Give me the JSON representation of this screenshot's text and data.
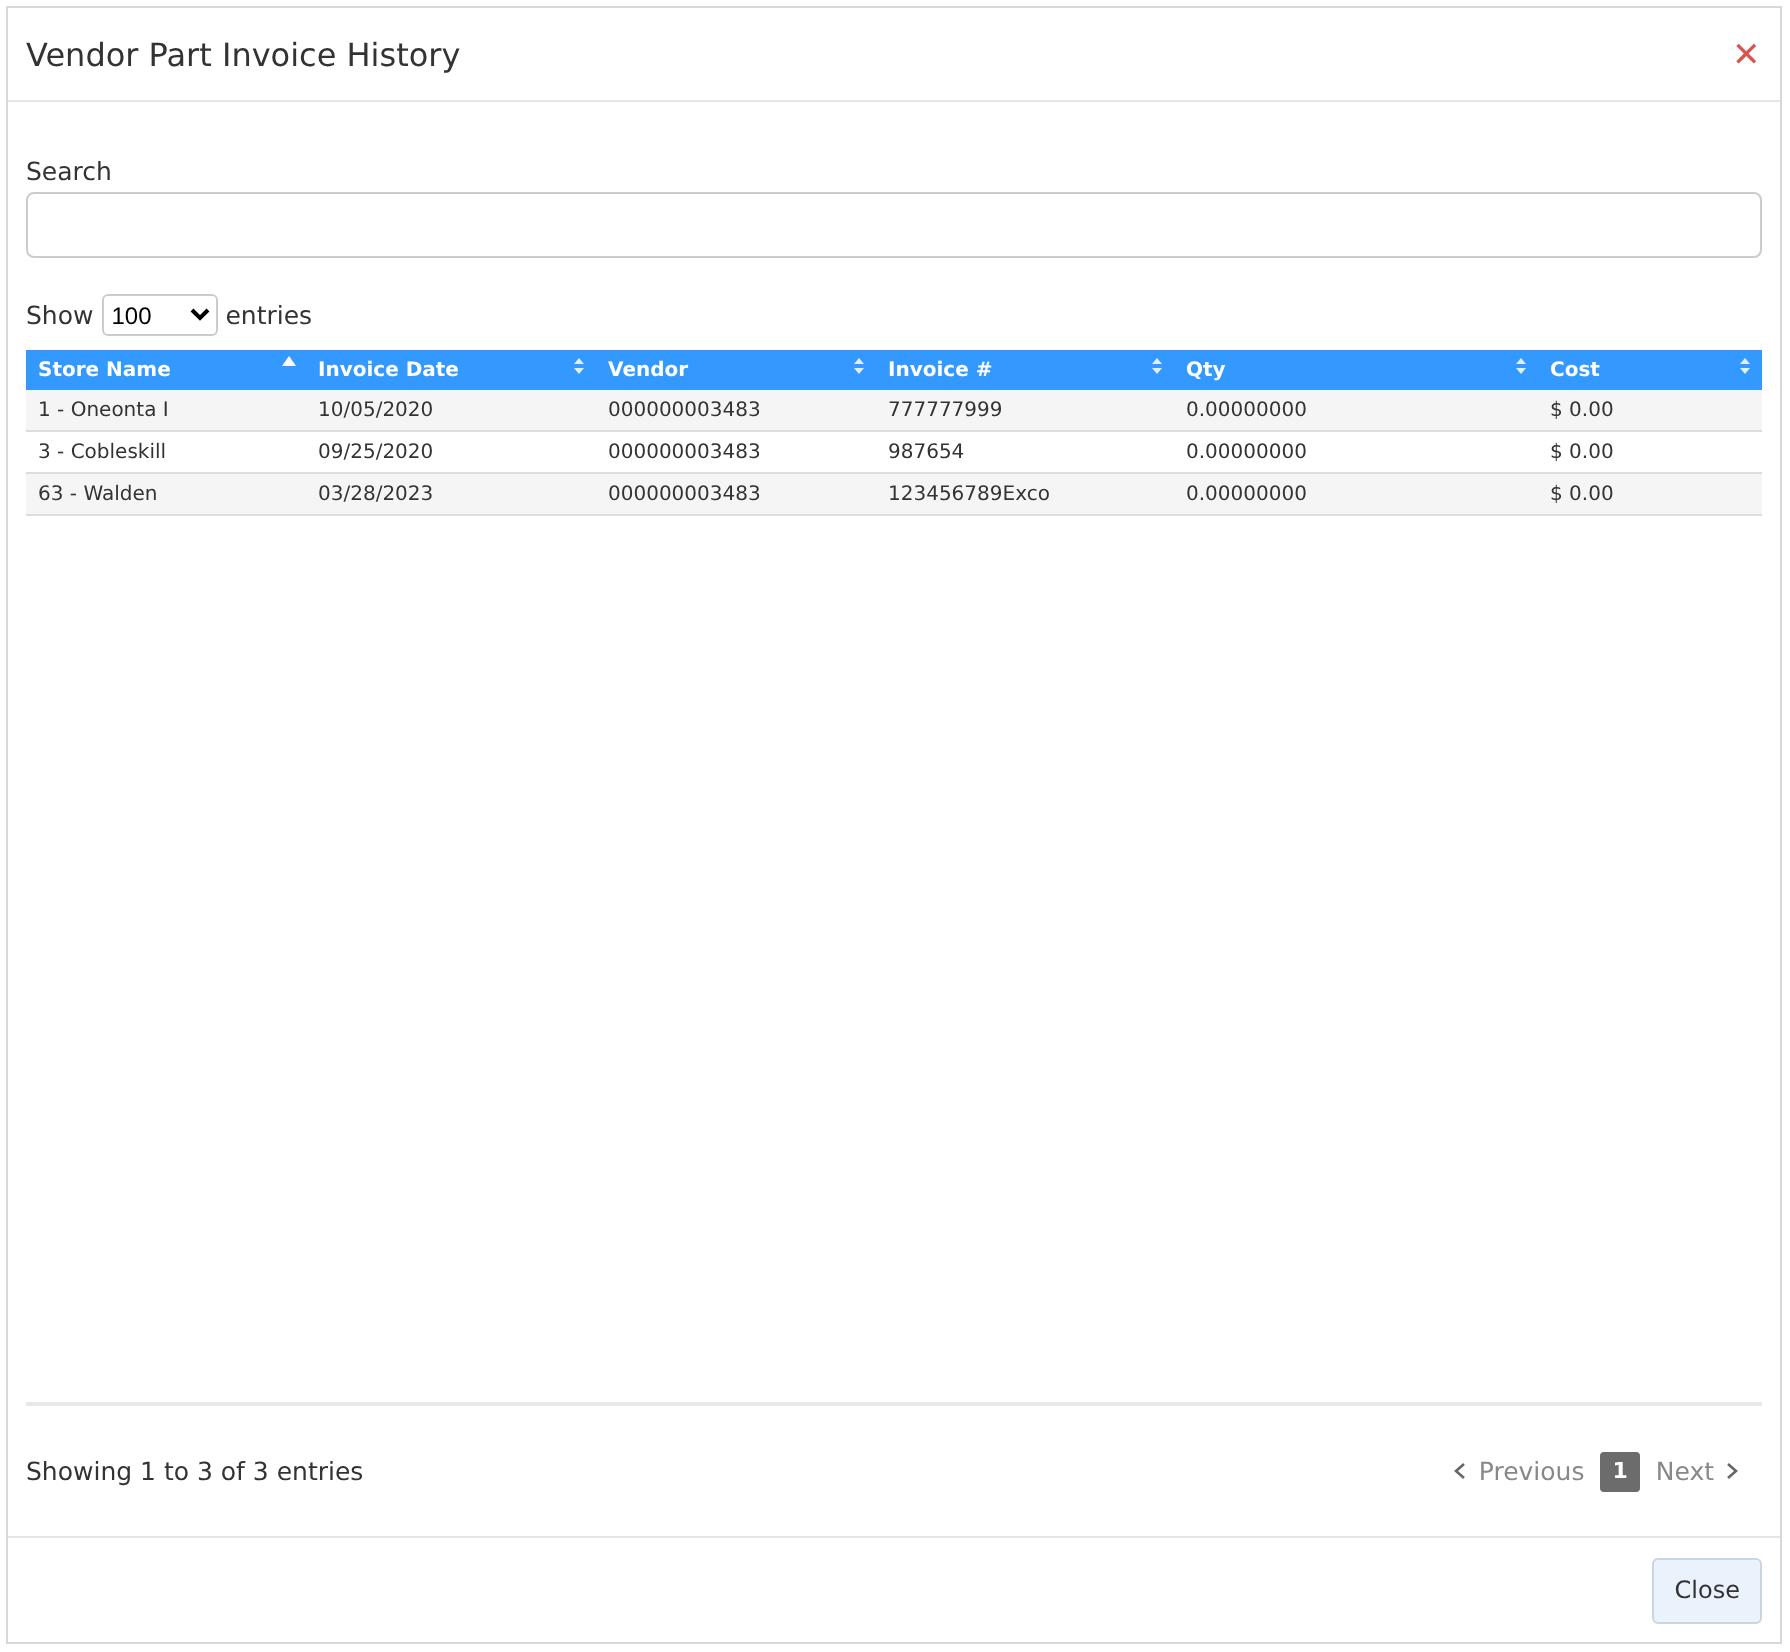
{
  "dialog": {
    "title": "Vendor Part Invoice History",
    "close_icon": "✕"
  },
  "search": {
    "label": "Search"
  },
  "length": {
    "prefix": "Show",
    "value": "100",
    "suffix": "entries"
  },
  "table": {
    "columns": [
      {
        "label": "Store Name",
        "sorted": true
      },
      {
        "label": "Invoice Date",
        "sorted": false
      },
      {
        "label": "Vendor",
        "sorted": false
      },
      {
        "label": "Invoice #",
        "sorted": false
      },
      {
        "label": "Qty",
        "sorted": false
      },
      {
        "label": "Cost",
        "sorted": false
      }
    ],
    "rows": [
      [
        "1 - Oneonta I",
        "10/05/2020",
        "000000003483",
        "777777999",
        "0.00000000",
        "$ 0.00"
      ],
      [
        "3 - Cobleskill",
        "09/25/2020",
        "000000003483",
        "987654",
        "0.00000000",
        "$ 0.00"
      ],
      [
        "63 - Walden",
        "03/28/2023",
        "000000003483",
        "123456789Exco",
        "0.00000000",
        "$ 0.00"
      ]
    ]
  },
  "info": "Showing 1 to 3 of 3 entries",
  "pagination": {
    "previous": {
      "label": "Previous",
      "disabled": true
    },
    "pages": [
      {
        "label": "1",
        "selected": true
      }
    ],
    "next": {
      "label": "Next",
      "disabled": true
    }
  },
  "footer": {
    "close_button": "Close"
  }
}
